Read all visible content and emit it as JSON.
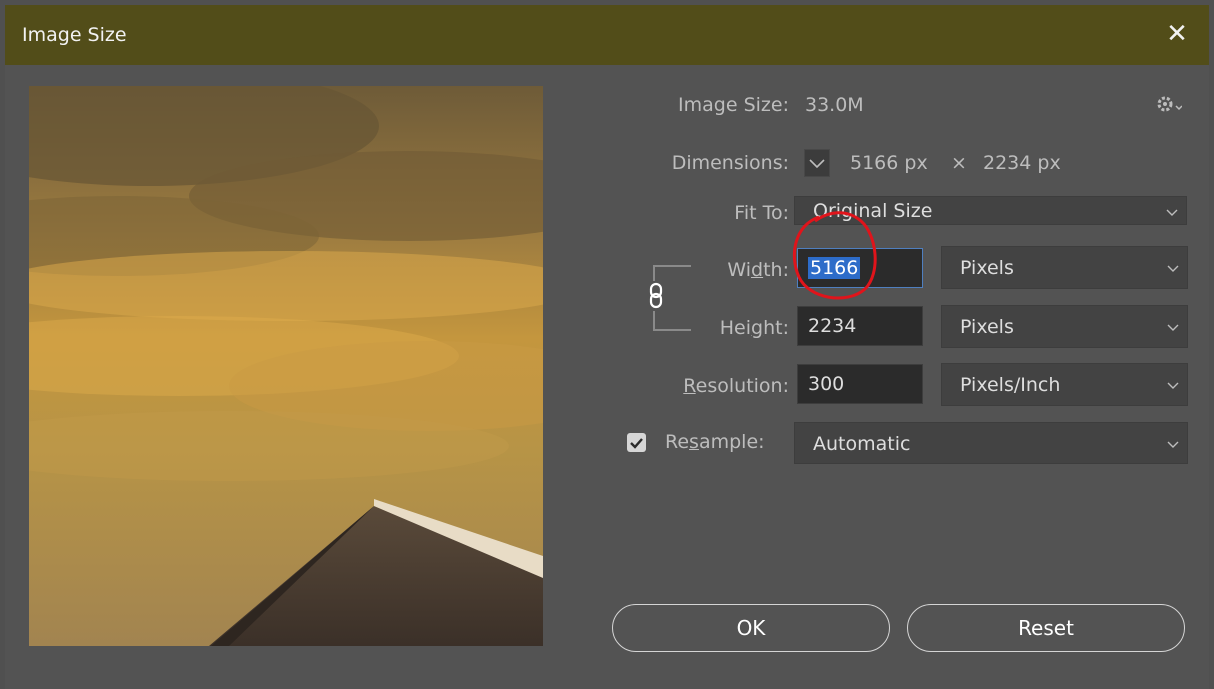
{
  "window": {
    "title": "Image Size",
    "close_glyph": "✕"
  },
  "info": {
    "image_size_label": "Image Size:",
    "image_size_value": "33.0M",
    "dimensions_label": "Dimensions:",
    "dimensions_width": "5166 px",
    "dimensions_sep": "×",
    "dimensions_height": "2234 px"
  },
  "fit_to": {
    "label": "Fit To:",
    "value": "Original Size"
  },
  "width": {
    "label_pre": "Wi",
    "label_u": "d",
    "label_post": "th:",
    "value": "5166",
    "unit": "Pixels"
  },
  "height": {
    "label_pre": "Hei",
    "label_u": "g",
    "label_post": "ht:",
    "value": "2234",
    "unit": "Pixels"
  },
  "resolution": {
    "label_u": "R",
    "label_post": "esolution:",
    "value": "300",
    "unit": "Pixels/Inch"
  },
  "resample": {
    "label_pre": "Re",
    "label_u": "s",
    "label_post": "ample:",
    "checked": true,
    "value": "Automatic"
  },
  "buttons": {
    "ok": "OK",
    "reset": "Reset"
  },
  "icons": {
    "gear": "gear-icon",
    "close": "close-icon",
    "chain": "chain-link-icon",
    "dimensions_dropdown": "chevron-down-icon",
    "checkbox": "checkmark-icon"
  },
  "colors": {
    "title_bar": "#524d19",
    "dialog_bg": "#535353",
    "field_bg": "#2b2b2b",
    "selection": "#2d6cc9",
    "annotation": "#e0141b"
  }
}
